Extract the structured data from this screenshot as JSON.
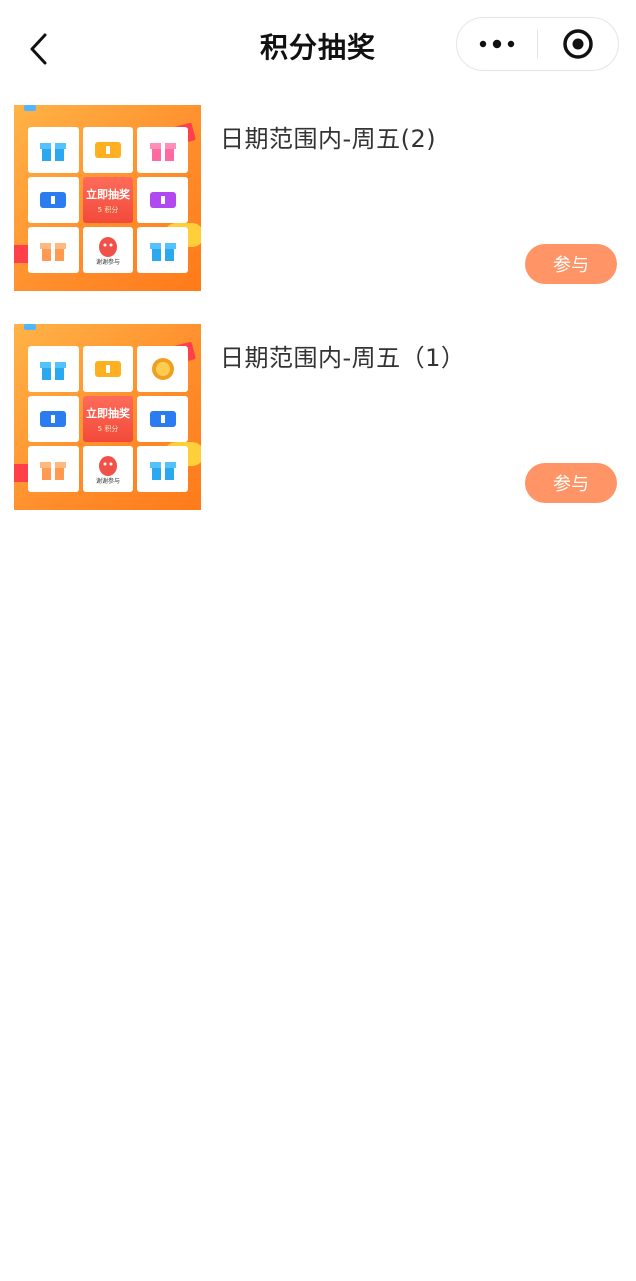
{
  "navbar": {
    "title": "积分抽奖",
    "back_icon": "chevron-left-icon",
    "more_icon": "more-dots-icon",
    "target_icon": "target-icon"
  },
  "items": [
    {
      "title": "日期范围内-周五(2)",
      "button_label": "参与",
      "thumb": {
        "center_text": "立即抽奖",
        "center_sub": "5 积分",
        "bottom_text": "谢谢参与"
      }
    },
    {
      "title": "日期范围内-周五（1）",
      "button_label": "参与",
      "thumb": {
        "center_text": "立即抽奖",
        "center_sub": "5 积分",
        "bottom_text": "谢谢参与"
      }
    }
  ],
  "colors": {
    "accent": "#ff9566",
    "thumb_bg": "#ff8c2a",
    "center_tile": "#f24a3a"
  }
}
